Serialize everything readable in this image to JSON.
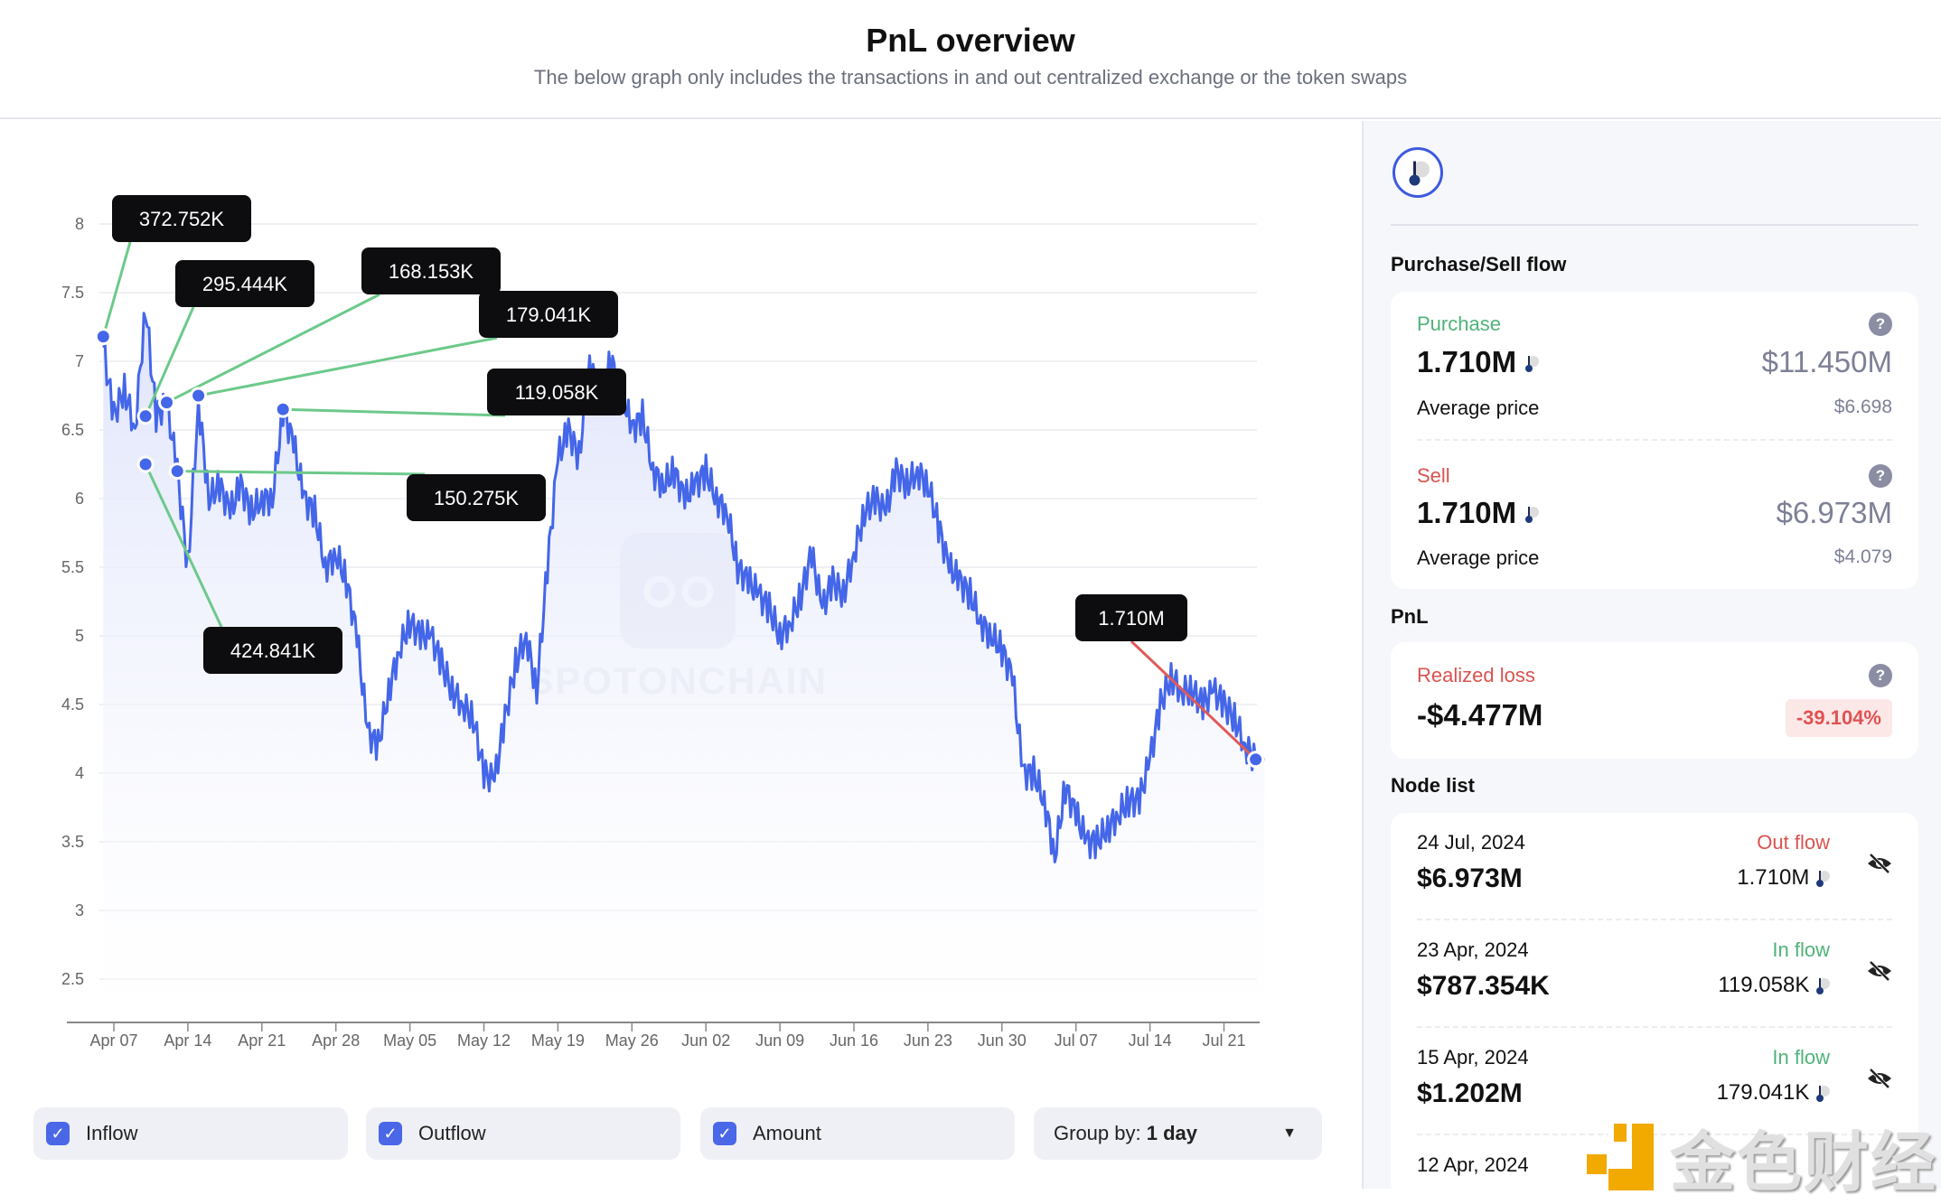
{
  "header": {
    "title": "PnL overview",
    "subtitle": "The below graph only includes the transactions in and out centralized exchange or the token swaps"
  },
  "chart_data": {
    "type": "line",
    "yticks": [
      "8",
      "7.5",
      "7",
      "6.5",
      "6",
      "5.5",
      "5",
      "4.5",
      "4",
      "3.5",
      "3",
      "2.5"
    ],
    "ylim": [
      2.5,
      8
    ],
    "xticks": [
      "Apr 07",
      "Apr 14",
      "Apr 21",
      "Apr 28",
      "May 05",
      "May 12",
      "May 19",
      "May 26",
      "Jun 02",
      "Jun 09",
      "Jun 16",
      "Jun 23",
      "Jun 30",
      "Jul 07",
      "Jul 14",
      "Jul 21"
    ],
    "grid": true,
    "line_color": "#4466e8",
    "x": [
      "2024-04-06",
      "2024-04-07",
      "2024-04-08",
      "2024-04-09",
      "2024-04-10",
      "2024-04-11",
      "2024-04-12",
      "2024-04-13",
      "2024-04-14",
      "2024-04-15",
      "2024-04-16",
      "2024-04-17",
      "2024-04-18",
      "2024-04-19",
      "2024-04-20",
      "2024-04-21",
      "2024-04-22",
      "2024-04-23",
      "2024-04-24",
      "2024-04-25",
      "2024-04-26",
      "2024-04-27",
      "2024-04-28",
      "2024-04-29",
      "2024-04-30",
      "2024-05-01",
      "2024-05-02",
      "2024-05-03",
      "2024-05-04",
      "2024-05-05",
      "2024-05-06",
      "2024-05-07",
      "2024-05-08",
      "2024-05-09",
      "2024-05-10",
      "2024-05-11",
      "2024-05-12",
      "2024-05-13",
      "2024-05-14",
      "2024-05-15",
      "2024-05-16",
      "2024-05-17",
      "2024-05-18",
      "2024-05-19",
      "2024-05-20",
      "2024-05-21",
      "2024-05-22",
      "2024-05-23",
      "2024-05-24",
      "2024-05-25",
      "2024-05-26",
      "2024-05-27",
      "2024-05-28",
      "2024-05-29",
      "2024-05-30",
      "2024-05-31",
      "2024-06-01",
      "2024-06-02",
      "2024-06-03",
      "2024-06-04",
      "2024-06-05",
      "2024-06-06",
      "2024-06-07",
      "2024-06-08",
      "2024-06-09",
      "2024-06-10",
      "2024-06-11",
      "2024-06-12",
      "2024-06-13",
      "2024-06-14",
      "2024-06-15",
      "2024-06-16",
      "2024-06-17",
      "2024-06-18",
      "2024-06-19",
      "2024-06-20",
      "2024-06-21",
      "2024-06-22",
      "2024-06-23",
      "2024-06-24",
      "2024-06-25",
      "2024-06-26",
      "2024-06-27",
      "2024-06-28",
      "2024-06-29",
      "2024-06-30",
      "2024-07-01",
      "2024-07-02",
      "2024-07-03",
      "2024-07-04",
      "2024-07-05",
      "2024-07-06",
      "2024-07-07",
      "2024-07-08",
      "2024-07-09",
      "2024-07-10",
      "2024-07-11",
      "2024-07-12",
      "2024-07-13",
      "2024-07-14",
      "2024-07-15",
      "2024-07-16",
      "2024-07-17",
      "2024-07-18",
      "2024-07-19",
      "2024-07-20",
      "2024-07-21",
      "2024-07-22",
      "2024-07-23",
      "2024-07-24"
    ],
    "y": [
      7.1,
      6.6,
      6.8,
      6.5,
      7.4,
      6.6,
      6.7,
      6.2,
      5.5,
      6.7,
      6.0,
      6.1,
      5.9,
      6.1,
      5.9,
      6.0,
      6.0,
      6.65,
      6.4,
      6.0,
      5.9,
      5.5,
      5.6,
      5.4,
      5.0,
      4.3,
      4.2,
      4.6,
      4.9,
      5.1,
      5.0,
      5.0,
      4.8,
      4.6,
      4.5,
      4.4,
      4.0,
      3.95,
      4.4,
      4.8,
      5.0,
      4.6,
      5.5,
      6.3,
      6.5,
      6.3,
      7.0,
      6.7,
      7.0,
      6.8,
      6.5,
      6.6,
      6.2,
      6.1,
      6.2,
      6.0,
      6.1,
      6.2,
      6.0,
      5.9,
      5.5,
      5.4,
      5.3,
      5.2,
      5.0,
      5.1,
      5.3,
      5.6,
      5.2,
      5.4,
      5.3,
      5.6,
      5.9,
      6.0,
      5.9,
      6.2,
      6.1,
      6.2,
      6.1,
      5.8,
      5.5,
      5.4,
      5.3,
      5.1,
      5.0,
      4.9,
      4.7,
      4.0,
      4.0,
      3.8,
      3.4,
      3.9,
      3.7,
      3.5,
      3.5,
      3.6,
      3.7,
      3.8,
      3.8,
      4.1,
      4.5,
      4.7,
      4.6,
      4.6,
      4.5,
      4.6,
      4.5,
      4.4,
      4.2,
      4.1
    ],
    "annotations": [
      {
        "date": "2024-04-06",
        "price": 7.18,
        "label": "372.752K",
        "flow": "in"
      },
      {
        "date": "2024-04-10",
        "price": 6.6,
        "label": "295.444K",
        "flow": "in"
      },
      {
        "date": "2024-04-12",
        "price": 6.7,
        "label": "168.153K",
        "flow": "in"
      },
      {
        "date": "2024-04-15",
        "price": 6.75,
        "label": "179.041K",
        "flow": "in"
      },
      {
        "date": "2024-04-23",
        "price": 6.65,
        "label": "119.058K",
        "flow": "in"
      },
      {
        "date": "2024-04-13",
        "price": 6.2,
        "label": "150.275K",
        "flow": "in"
      },
      {
        "date": "2024-04-10",
        "price": 6.25,
        "label": "424.841K",
        "flow": "in"
      },
      {
        "date": "2024-07-24",
        "price": 4.1,
        "label": "1.710M",
        "flow": "out"
      }
    ],
    "colors": {
      "in": "#6cc98a",
      "out": "#e05a5a"
    },
    "watermark": "SPOTONCHAIN"
  },
  "controls": {
    "inflow": "Inflow",
    "outflow": "Outflow",
    "amount": "Amount",
    "group_label": "Group by:",
    "group_value": "1 day"
  },
  "panel": {
    "section_flow": "Purchase/Sell flow",
    "purchase": {
      "label": "Purchase",
      "amount": "1.710M",
      "value": "$11.450M",
      "avg_label": "Average price",
      "avg": "$6.698"
    },
    "sell": {
      "label": "Sell",
      "amount": "1.710M",
      "value": "$6.973M",
      "avg_label": "Average price",
      "avg": "$4.079"
    },
    "section_pnl": "PnL",
    "pnl": {
      "label": "Realized loss",
      "value": "-$4.477M",
      "pct": "-39.104%"
    },
    "section_nodes": "Node list",
    "nodes": [
      {
        "date": "24 Jul, 2024",
        "value": "$6.973M",
        "flow": "Out flow",
        "amount": "1.710M"
      },
      {
        "date": "23 Apr, 2024",
        "value": "$787.354K",
        "flow": "In flow",
        "amount": "119.058K"
      },
      {
        "date": "15 Apr, 2024",
        "value": "$1.202M",
        "flow": "In flow",
        "amount": "179.041K"
      },
      {
        "date": "12 Apr, 2024",
        "value": "",
        "flow": "",
        "amount": ""
      }
    ],
    "help": "?"
  },
  "watermark_logo": "金色财经"
}
